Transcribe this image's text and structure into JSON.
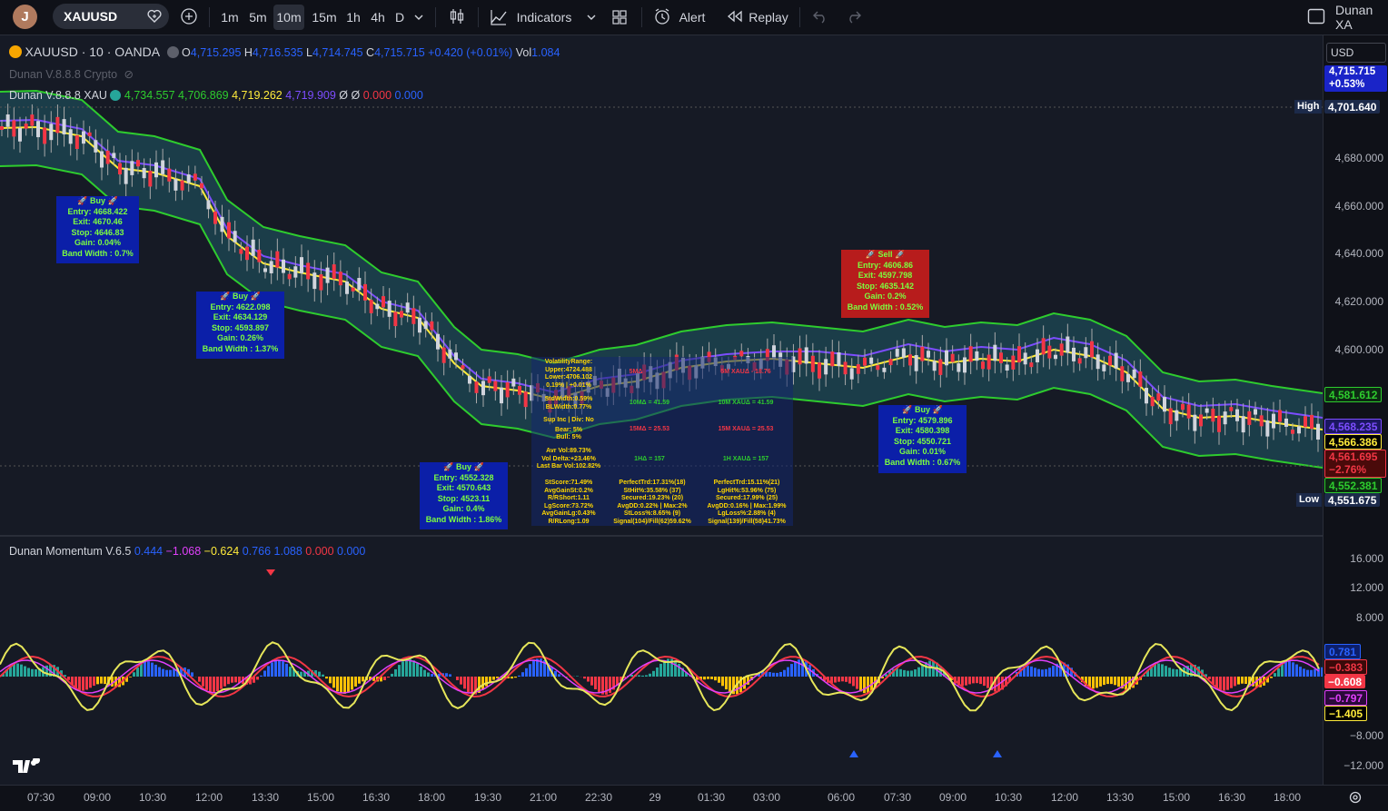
{
  "topbar": {
    "avatar_letter": "J",
    "symbol": "XAUUSD",
    "intervals": [
      "1m",
      "5m",
      "10m",
      "15m",
      "1h",
      "4h",
      "D"
    ],
    "active_interval": "10m",
    "indicators_label": "Indicators",
    "alert_label": "Alert",
    "replay_label": "Replay",
    "right_label": "Dunan XA"
  },
  "legend": {
    "title": "XAUUSD · 10 · OANDA",
    "o_label": "O",
    "o_val": "4,715.295",
    "h_label": "H",
    "h_val": "4,716.535",
    "l_label": "L",
    "l_val": "4,714.745",
    "c_label": "C",
    "c_val": "4,715.715",
    "change": "+0.420 (+0.01%)",
    "vol_label": "Vol",
    "vol_val": "1.084",
    "ind1_name": "Dunan V.8.8.8 Crypto",
    "ind2_name": "Dunan V.8.8.8 XAU",
    "ind2_v1": "4,734.557",
    "ind2_v2": "4,706.869",
    "ind2_v3": "4,719.262",
    "ind2_v4": "4,719.909",
    "ind2_v5": "Ø",
    "ind2_v6": "Ø",
    "ind2_v7": "0.000",
    "ind2_v8": "0.000",
    "mom_name": "Dunan Momentum V.6.5",
    "mom_v1": "0.444",
    "mom_v2": "−1.068",
    "mom_v3": "−0.624",
    "mom_v4": "0.766",
    "mom_v5": "1.088",
    "mom_v6": "0.000",
    "mom_v7": "0.000"
  },
  "price_axis": {
    "currency": "USD",
    "labels": [
      "4,680.000",
      "4,660.000",
      "4,640.000",
      "4,620.000",
      "4,600.000"
    ],
    "last_price": "4,715.715",
    "last_change": "+0.53%",
    "high_label": "High",
    "high_val": "4,701.640",
    "low_label": "Low",
    "low_val": "4,551.675",
    "tag1": "4,581.612",
    "tag2": "4,568.235",
    "tag3": "4,566.386",
    "tag4": "4,561.695",
    "tag4b": "−2.76%",
    "tag5": "4,552.381",
    "mom_labels": [
      "16.000",
      "12.000",
      "8.000",
      "−8.000",
      "−12.000"
    ],
    "mom_tags": [
      "0.781",
      "−0.383",
      "−0.608",
      "−0.797",
      "−1.405"
    ]
  },
  "time_axis": [
    "07:30",
    "09:00",
    "10:30",
    "12:00",
    "13:30",
    "15:00",
    "16:30",
    "18:00",
    "19:30",
    "21:00",
    "22:30",
    "29",
    "01:30",
    "03:00",
    "06:00",
    "07:30",
    "09:00",
    "10:30",
    "12:00",
    "13:30",
    "15:00",
    "16:30",
    "18:00"
  ],
  "signals": [
    {
      "title": "🚀 Buy 🚀",
      "entry": "Entry: 4668.422",
      "exit": "Exit: 4670.46",
      "stop": "Stop: 4646.83",
      "gain": "Gain: 0.04%",
      "bw": "Band Width : 0.7%"
    },
    {
      "title": "🚀 Buy 🚀",
      "entry": "Entry: 4622.098",
      "exit": "Exit: 4634.129",
      "stop": "Stop: 4593.897",
      "gain": "Gain: 0.26%",
      "bw": "Band Width : 1.37%"
    },
    {
      "title": "🚀 Buy 🚀",
      "entry": "Entry: 4552.328",
      "exit": "Exit: 4570.643",
      "stop": "Stop: 4523.11",
      "gain": "Gain: 0.4%",
      "bw": "Band Width : 1.86%"
    },
    {
      "title": "🚀 Sell 🚀",
      "entry": "Entry: 4606.86",
      "exit": "Exit: 4597.798",
      "stop": "Stop: 4635.142",
      "gain": "Gain: 0.2%",
      "bw": "Band Width : 0.52%"
    },
    {
      "title": "🚀 Buy 🚀",
      "entry": "Entry: 4579.896",
      "exit": "Exit: 4580.398",
      "stop": "Stop: 4550.721",
      "gain": "Gain: 0.01%",
      "bw": "Band Width : 0.67%"
    }
  ],
  "stats": {
    "vol": [
      "VolatilityRange:",
      "Upper:4724.488",
      "Lower:4706.102",
      "0.19% | +0.01%"
    ],
    "mid": [
      "StdWidth:0.59%",
      "BLWidth:0.77%",
      "Sup Inc | Div: No",
      "Bear: 5%",
      "Bull: 5%"
    ],
    "avr": [
      "Avr Vol:89.73%",
      "Vol Delta:+23.46%",
      "Last Bar Vol:102.82%"
    ],
    "score": [
      "StScore:71.49%",
      "AvgGainSt:0.2%",
      "R/RShort:1.11",
      "LgScore:73.72%",
      "AvgGainLg:0.43%",
      "R/RLong:1.09"
    ],
    "perf1": [
      "PerfectTrd:17.31%(18)",
      "StHit%:35.58% (37)",
      "Secured:19.23% (20)",
      "AvgDD:0.22% | Max:2%",
      "StLoss%:8.65% (9)",
      "Signal(104)/Fill(62)59.62%"
    ],
    "perf2": [
      "PerfectTrd:15.11%(21)",
      "LgHit%:53.96% (75)",
      "Secured:17.99% (25)",
      "AvgDD:0.16% | Max:1.99%",
      "LgLoss%:2.88% (4)",
      "Signal(139)/Fill(58)41.73%"
    ],
    "mtf": [
      "5MΔ",
      "5M XAUΔ - 18.76",
      "10MΔ = 41.59",
      "10M XAUΔ = 41.59",
      "15MΔ = 25.53",
      "15M XAUΔ = 25.53",
      "1HΔ = 157",
      "1H XAUΔ = 157"
    ]
  }
}
